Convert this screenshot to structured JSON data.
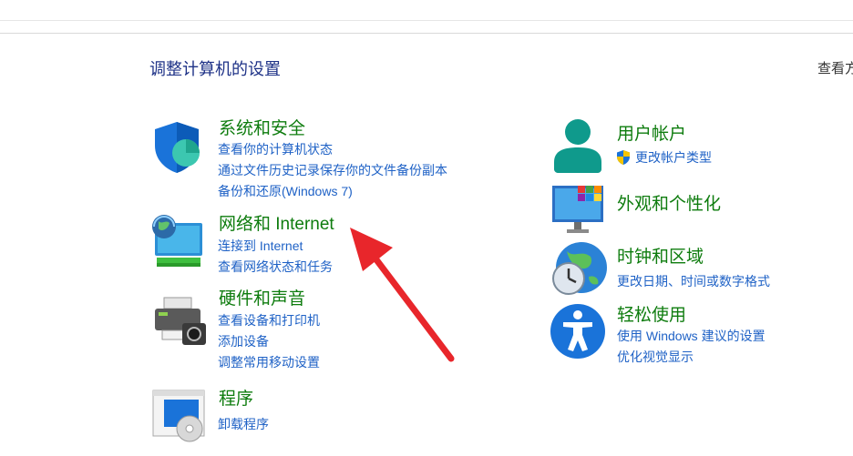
{
  "header": {
    "title": "调整计算机的设置",
    "view_by": "查看方"
  },
  "left_categories": [
    {
      "title": "系统和安全",
      "icon": "shield-icon",
      "links": [
        "查看你的计算机状态",
        "通过文件历史记录保存你的文件备份副本",
        "备份和还原(Windows 7)"
      ]
    },
    {
      "title": "网络和 Internet",
      "icon": "globe-network-icon",
      "links": [
        "连接到 Internet",
        "查看网络状态和任务"
      ]
    },
    {
      "title": "硬件和声音",
      "icon": "printer-icon",
      "links": [
        "查看设备和打印机",
        "添加设备",
        "调整常用移动设置"
      ]
    },
    {
      "title": "程序",
      "icon": "program-disc-icon",
      "links": [
        "卸载程序"
      ]
    }
  ],
  "right_categories": [
    {
      "title": "用户帐户",
      "icon": "user-icon",
      "links": [
        "更改帐户类型"
      ]
    },
    {
      "title": "外观和个性化",
      "icon": "monitor-icon",
      "links": []
    },
    {
      "title": "时钟和区域",
      "icon": "clock-globe-icon",
      "links": [
        "更改日期、时间或数字格式"
      ]
    },
    {
      "title": "轻松使用",
      "icon": "accessibility-icon",
      "links": [
        "使用 Windows 建议的设置",
        "优化视觉显示"
      ]
    }
  ],
  "colors": {
    "category_title": "#0e7c0e",
    "link": "#1f62c6",
    "page_title": "#1e3287",
    "arrow": "#e8262b"
  }
}
